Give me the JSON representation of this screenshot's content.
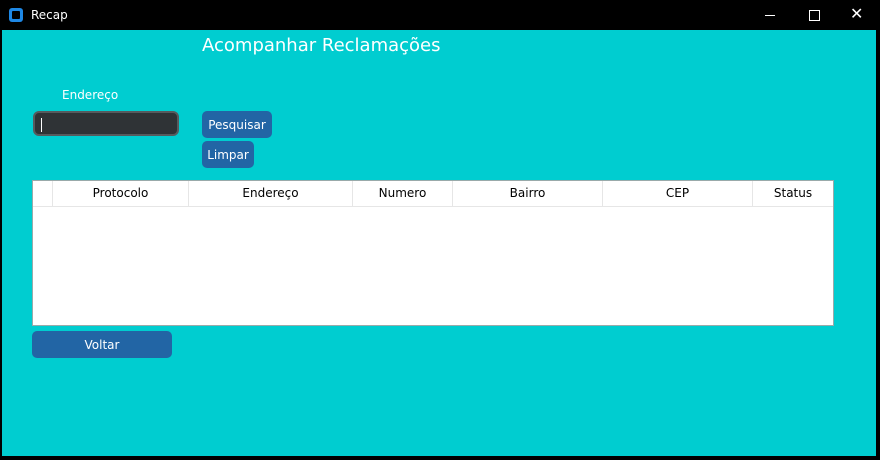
{
  "window": {
    "title": "Recap",
    "close_glyph": "✕"
  },
  "main": {
    "heading": "Acompanhar Reclamações",
    "address_label": "Endereço",
    "address_value": "",
    "buttons": {
      "search": "Pesquisar",
      "clear": "Limpar",
      "back": "Voltar"
    },
    "table": {
      "columns": [
        "",
        "Protocolo",
        "Endereço",
        "Numero",
        "Bairro",
        "CEP",
        "Status"
      ],
      "rows": []
    }
  },
  "colors": {
    "background": "#00cdd0",
    "button": "#2265a5",
    "titlebar": "#000000"
  }
}
